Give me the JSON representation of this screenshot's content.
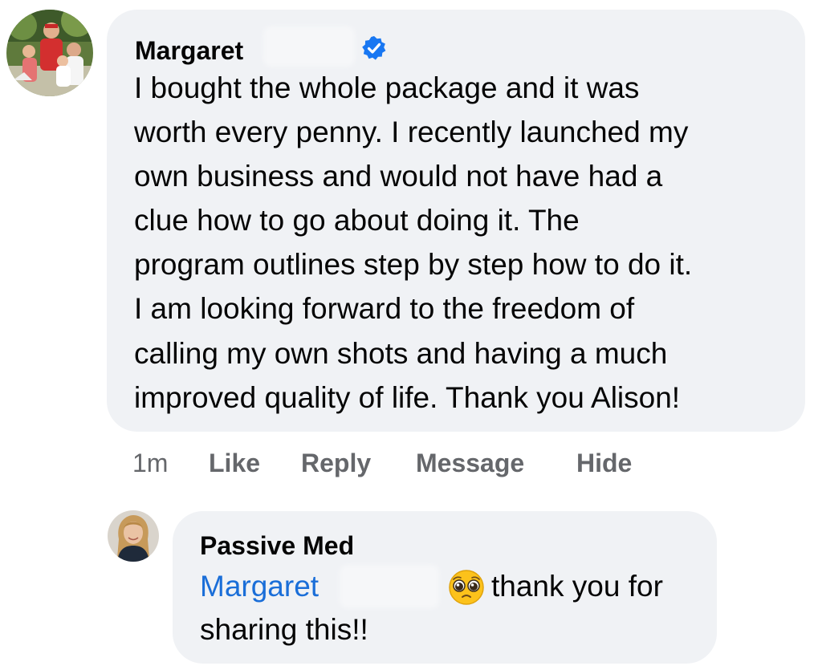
{
  "colors": {
    "bubble": "#f0f2f5",
    "mention": "#1a6ed8",
    "verified": "#1877f2",
    "meta_text": "#65676b"
  },
  "comment": {
    "author": "Margaret",
    "verified_icon": "verified-badge-icon",
    "text": "I bought the whole package and it was\nworth every penny.  I recently launched my\nown business and would not have had a\nclue how to go about doing it.  The\nprogram outlines step by step how to do it.\nI am looking forward to the freedom of\ncalling my own shots and having a much\nimproved quality of life.  Thank you Alison!",
    "time": "1m",
    "actions": {
      "like": "Like",
      "reply": "Reply",
      "message": "Message",
      "hide": "Hide"
    }
  },
  "reply": {
    "author": "Passive Med",
    "mention": "Margaret",
    "emoji": "pleading-face-emoji",
    "text_line1": "thank you for",
    "text_line2": "sharing this!!"
  }
}
